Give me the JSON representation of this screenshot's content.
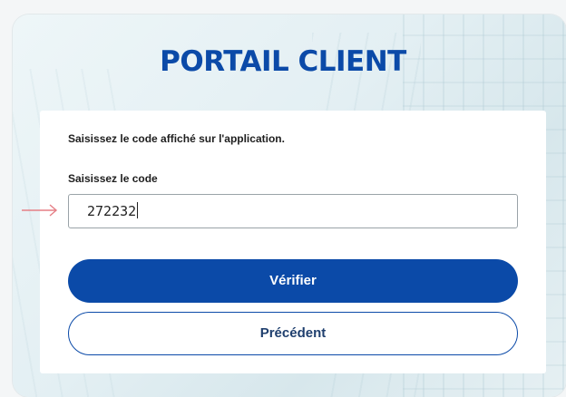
{
  "portal": {
    "title": "PORTAIL CLIENT"
  },
  "form": {
    "instruction": "Saisissez le code affiché sur l'application.",
    "code_label": "Saisissez le code",
    "code_value": "272232",
    "verify_label": "Vérifier",
    "back_label": "Précédent"
  },
  "colors": {
    "brand": "#0b4aa8",
    "annotation_arrow": "#e57f86"
  },
  "icons": {
    "annotation": "arrow-right-icon"
  }
}
